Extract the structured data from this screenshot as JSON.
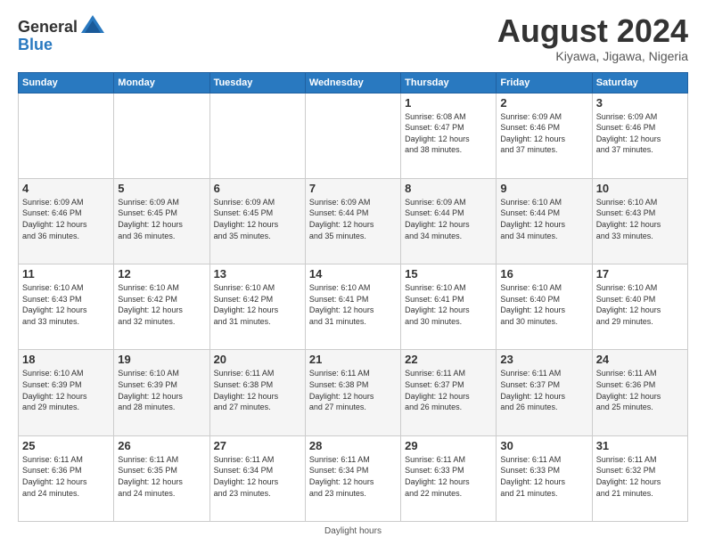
{
  "header": {
    "logo_general": "General",
    "logo_blue": "Blue",
    "month_title": "August 2024",
    "location": "Kiyawa, Jigawa, Nigeria"
  },
  "days_of_week": [
    "Sunday",
    "Monday",
    "Tuesday",
    "Wednesday",
    "Thursday",
    "Friday",
    "Saturday"
  ],
  "weeks": [
    [
      {
        "day": "",
        "info": ""
      },
      {
        "day": "",
        "info": ""
      },
      {
        "day": "",
        "info": ""
      },
      {
        "day": "",
        "info": ""
      },
      {
        "day": "1",
        "info": "Sunrise: 6:08 AM\nSunset: 6:47 PM\nDaylight: 12 hours\nand 38 minutes."
      },
      {
        "day": "2",
        "info": "Sunrise: 6:09 AM\nSunset: 6:46 PM\nDaylight: 12 hours\nand 37 minutes."
      },
      {
        "day": "3",
        "info": "Sunrise: 6:09 AM\nSunset: 6:46 PM\nDaylight: 12 hours\nand 37 minutes."
      }
    ],
    [
      {
        "day": "4",
        "info": "Sunrise: 6:09 AM\nSunset: 6:46 PM\nDaylight: 12 hours\nand 36 minutes."
      },
      {
        "day": "5",
        "info": "Sunrise: 6:09 AM\nSunset: 6:45 PM\nDaylight: 12 hours\nand 36 minutes."
      },
      {
        "day": "6",
        "info": "Sunrise: 6:09 AM\nSunset: 6:45 PM\nDaylight: 12 hours\nand 35 minutes."
      },
      {
        "day": "7",
        "info": "Sunrise: 6:09 AM\nSunset: 6:44 PM\nDaylight: 12 hours\nand 35 minutes."
      },
      {
        "day": "8",
        "info": "Sunrise: 6:09 AM\nSunset: 6:44 PM\nDaylight: 12 hours\nand 34 minutes."
      },
      {
        "day": "9",
        "info": "Sunrise: 6:10 AM\nSunset: 6:44 PM\nDaylight: 12 hours\nand 34 minutes."
      },
      {
        "day": "10",
        "info": "Sunrise: 6:10 AM\nSunset: 6:43 PM\nDaylight: 12 hours\nand 33 minutes."
      }
    ],
    [
      {
        "day": "11",
        "info": "Sunrise: 6:10 AM\nSunset: 6:43 PM\nDaylight: 12 hours\nand 33 minutes."
      },
      {
        "day": "12",
        "info": "Sunrise: 6:10 AM\nSunset: 6:42 PM\nDaylight: 12 hours\nand 32 minutes."
      },
      {
        "day": "13",
        "info": "Sunrise: 6:10 AM\nSunset: 6:42 PM\nDaylight: 12 hours\nand 31 minutes."
      },
      {
        "day": "14",
        "info": "Sunrise: 6:10 AM\nSunset: 6:41 PM\nDaylight: 12 hours\nand 31 minutes."
      },
      {
        "day": "15",
        "info": "Sunrise: 6:10 AM\nSunset: 6:41 PM\nDaylight: 12 hours\nand 30 minutes."
      },
      {
        "day": "16",
        "info": "Sunrise: 6:10 AM\nSunset: 6:40 PM\nDaylight: 12 hours\nand 30 minutes."
      },
      {
        "day": "17",
        "info": "Sunrise: 6:10 AM\nSunset: 6:40 PM\nDaylight: 12 hours\nand 29 minutes."
      }
    ],
    [
      {
        "day": "18",
        "info": "Sunrise: 6:10 AM\nSunset: 6:39 PM\nDaylight: 12 hours\nand 29 minutes."
      },
      {
        "day": "19",
        "info": "Sunrise: 6:10 AM\nSunset: 6:39 PM\nDaylight: 12 hours\nand 28 minutes."
      },
      {
        "day": "20",
        "info": "Sunrise: 6:11 AM\nSunset: 6:38 PM\nDaylight: 12 hours\nand 27 minutes."
      },
      {
        "day": "21",
        "info": "Sunrise: 6:11 AM\nSunset: 6:38 PM\nDaylight: 12 hours\nand 27 minutes."
      },
      {
        "day": "22",
        "info": "Sunrise: 6:11 AM\nSunset: 6:37 PM\nDaylight: 12 hours\nand 26 minutes."
      },
      {
        "day": "23",
        "info": "Sunrise: 6:11 AM\nSunset: 6:37 PM\nDaylight: 12 hours\nand 26 minutes."
      },
      {
        "day": "24",
        "info": "Sunrise: 6:11 AM\nSunset: 6:36 PM\nDaylight: 12 hours\nand 25 minutes."
      }
    ],
    [
      {
        "day": "25",
        "info": "Sunrise: 6:11 AM\nSunset: 6:36 PM\nDaylight: 12 hours\nand 24 minutes."
      },
      {
        "day": "26",
        "info": "Sunrise: 6:11 AM\nSunset: 6:35 PM\nDaylight: 12 hours\nand 24 minutes."
      },
      {
        "day": "27",
        "info": "Sunrise: 6:11 AM\nSunset: 6:34 PM\nDaylight: 12 hours\nand 23 minutes."
      },
      {
        "day": "28",
        "info": "Sunrise: 6:11 AM\nSunset: 6:34 PM\nDaylight: 12 hours\nand 23 minutes."
      },
      {
        "day": "29",
        "info": "Sunrise: 6:11 AM\nSunset: 6:33 PM\nDaylight: 12 hours\nand 22 minutes."
      },
      {
        "day": "30",
        "info": "Sunrise: 6:11 AM\nSunset: 6:33 PM\nDaylight: 12 hours\nand 21 minutes."
      },
      {
        "day": "31",
        "info": "Sunrise: 6:11 AM\nSunset: 6:32 PM\nDaylight: 12 hours\nand 21 minutes."
      }
    ]
  ],
  "footer": {
    "note": "Daylight hours"
  }
}
